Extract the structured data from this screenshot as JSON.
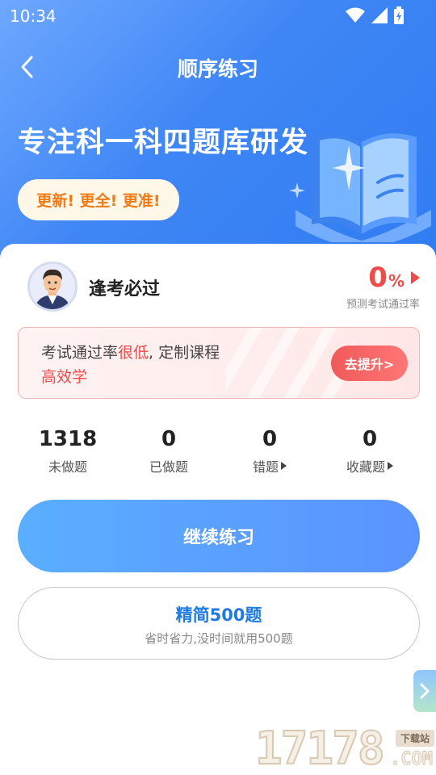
{
  "status_bar": {
    "time": "10:34",
    "icons": [
      "wifi-icon",
      "signal-icon",
      "battery-icon"
    ]
  },
  "header": {
    "back_icon": "chevron-left-icon",
    "title": "顺序练习"
  },
  "hero": {
    "headline": "专注科一科四题库研发",
    "badge": "更新! 更全! 更准!"
  },
  "profile": {
    "name": "逢考必过",
    "avatar": "avatar"
  },
  "pass_rate": {
    "value": "0",
    "unit": "%",
    "caption": "预测考试通过率"
  },
  "tip": {
    "text_before": "考试通过率",
    "highlight1": "很低",
    "text_middle": ", 定制课程",
    "highlight2": "高效学",
    "button": "去提升>"
  },
  "stats": [
    {
      "value": "1318",
      "label": "未做题"
    },
    {
      "value": "0",
      "label": "已做题"
    },
    {
      "value": "0",
      "label": "错题"
    },
    {
      "value": "0",
      "label": "收藏题"
    }
  ],
  "actions": {
    "primary": "继续练习",
    "secondary_title": "精简500题",
    "secondary_sub": "省时省力,没时间就用500题"
  },
  "watermark": {
    "digits": "17178",
    "tag": "下载站",
    "suffix": ".COM"
  },
  "colors": {
    "accent": "#3f86f5",
    "danger": "#ef4b4b",
    "badge_text": "#f07a16",
    "link_blue": "#1f7ae0"
  }
}
